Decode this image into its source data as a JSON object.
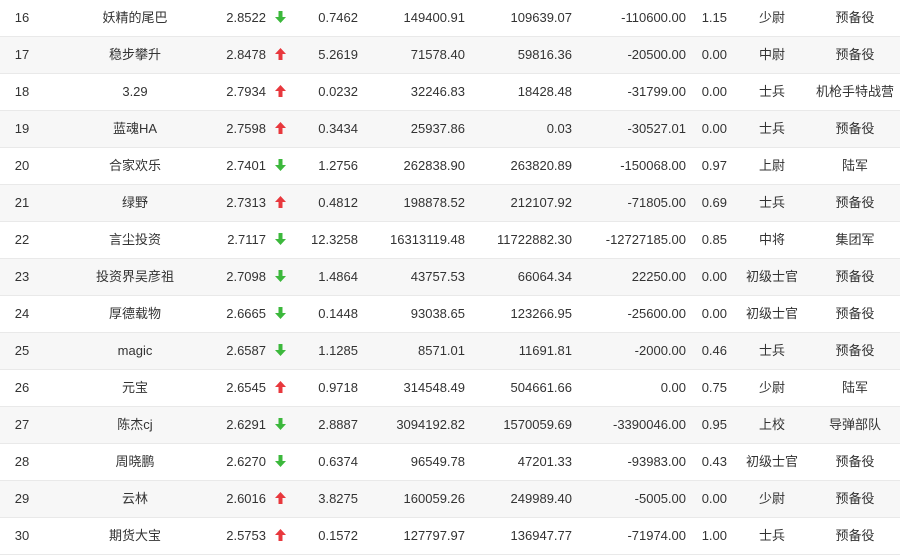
{
  "colors": {
    "up": "#e8383d",
    "down": "#3cb83c",
    "row_alt": "#f7f7f7",
    "border": "#e9e9e9"
  },
  "rows": [
    {
      "rank": "16",
      "name": "妖精的尾巴",
      "score": "2.8522",
      "trend": "down",
      "v1": "0.7462",
      "v2": "149400.91",
      "v3": "109639.07",
      "v4": "-110600.00",
      "v5": "1.15",
      "grade": "少尉",
      "unit": "预备役"
    },
    {
      "rank": "17",
      "name": "稳步攀升",
      "score": "2.8478",
      "trend": "up",
      "v1": "5.2619",
      "v2": "71578.40",
      "v3": "59816.36",
      "v4": "-20500.00",
      "v5": "0.00",
      "grade": "中尉",
      "unit": "预备役"
    },
    {
      "rank": "18",
      "name": "3.29",
      "score": "2.7934",
      "trend": "up",
      "v1": "0.0232",
      "v2": "32246.83",
      "v3": "18428.48",
      "v4": "-31799.00",
      "v5": "0.00",
      "grade": "士兵",
      "unit": "机枪手特战营"
    },
    {
      "rank": "19",
      "name": "蓝魂HA",
      "score": "2.7598",
      "trend": "up",
      "v1": "0.3434",
      "v2": "25937.86",
      "v3": "0.03",
      "v4": "-30527.01",
      "v5": "0.00",
      "grade": "士兵",
      "unit": "预备役"
    },
    {
      "rank": "20",
      "name": "合家欢乐",
      "score": "2.7401",
      "trend": "down",
      "v1": "1.2756",
      "v2": "262838.90",
      "v3": "263820.89",
      "v4": "-150068.00",
      "v5": "0.97",
      "grade": "上尉",
      "unit": "陆军"
    },
    {
      "rank": "21",
      "name": "绿野",
      "score": "2.7313",
      "trend": "up",
      "v1": "0.4812",
      "v2": "198878.52",
      "v3": "212107.92",
      "v4": "-71805.00",
      "v5": "0.69",
      "grade": "士兵",
      "unit": "预备役"
    },
    {
      "rank": "22",
      "name": "言尘投资",
      "score": "2.7117",
      "trend": "down",
      "v1": "12.3258",
      "v2": "16313119.48",
      "v3": "11722882.30",
      "v4": "-12727185.00",
      "v5": "0.85",
      "grade": "中将",
      "unit": "集团军"
    },
    {
      "rank": "23",
      "name": "投资界吴彦祖",
      "score": "2.7098",
      "trend": "down",
      "v1": "1.4864",
      "v2": "43757.53",
      "v3": "66064.34",
      "v4": "22250.00",
      "v5": "0.00",
      "grade": "初级士官",
      "unit": "预备役"
    },
    {
      "rank": "24",
      "name": "厚德载物",
      "score": "2.6665",
      "trend": "down",
      "v1": "0.1448",
      "v2": "93038.65",
      "v3": "123266.95",
      "v4": "-25600.00",
      "v5": "0.00",
      "grade": "初级士官",
      "unit": "预备役"
    },
    {
      "rank": "25",
      "name": "magic",
      "score": "2.6587",
      "trend": "down",
      "v1": "1.1285",
      "v2": "8571.01",
      "v3": "11691.81",
      "v4": "-2000.00",
      "v5": "0.46",
      "grade": "士兵",
      "unit": "预备役"
    },
    {
      "rank": "26",
      "name": "元宝",
      "score": "2.6545",
      "trend": "up",
      "v1": "0.9718",
      "v2": "314548.49",
      "v3": "504661.66",
      "v4": "0.00",
      "v5": "0.75",
      "grade": "少尉",
      "unit": "陆军"
    },
    {
      "rank": "27",
      "name": "陈杰cj",
      "score": "2.6291",
      "trend": "down",
      "v1": "2.8887",
      "v2": "3094192.82",
      "v3": "1570059.69",
      "v4": "-3390046.00",
      "v5": "0.95",
      "grade": "上校",
      "unit": "导弹部队"
    },
    {
      "rank": "28",
      "name": "周晓鹏",
      "score": "2.6270",
      "trend": "down",
      "v1": "0.6374",
      "v2": "96549.78",
      "v3": "47201.33",
      "v4": "-93983.00",
      "v5": "0.43",
      "grade": "初级士官",
      "unit": "预备役"
    },
    {
      "rank": "29",
      "name": "云林",
      "score": "2.6016",
      "trend": "up",
      "v1": "3.8275",
      "v2": "160059.26",
      "v3": "249989.40",
      "v4": "-5005.00",
      "v5": "0.00",
      "grade": "少尉",
      "unit": "预备役"
    },
    {
      "rank": "30",
      "name": "期货大宝",
      "score": "2.5753",
      "trend": "up",
      "v1": "0.1572",
      "v2": "127797.97",
      "v3": "136947.77",
      "v4": "-71974.00",
      "v5": "1.00",
      "grade": "士兵",
      "unit": "预备役"
    }
  ]
}
